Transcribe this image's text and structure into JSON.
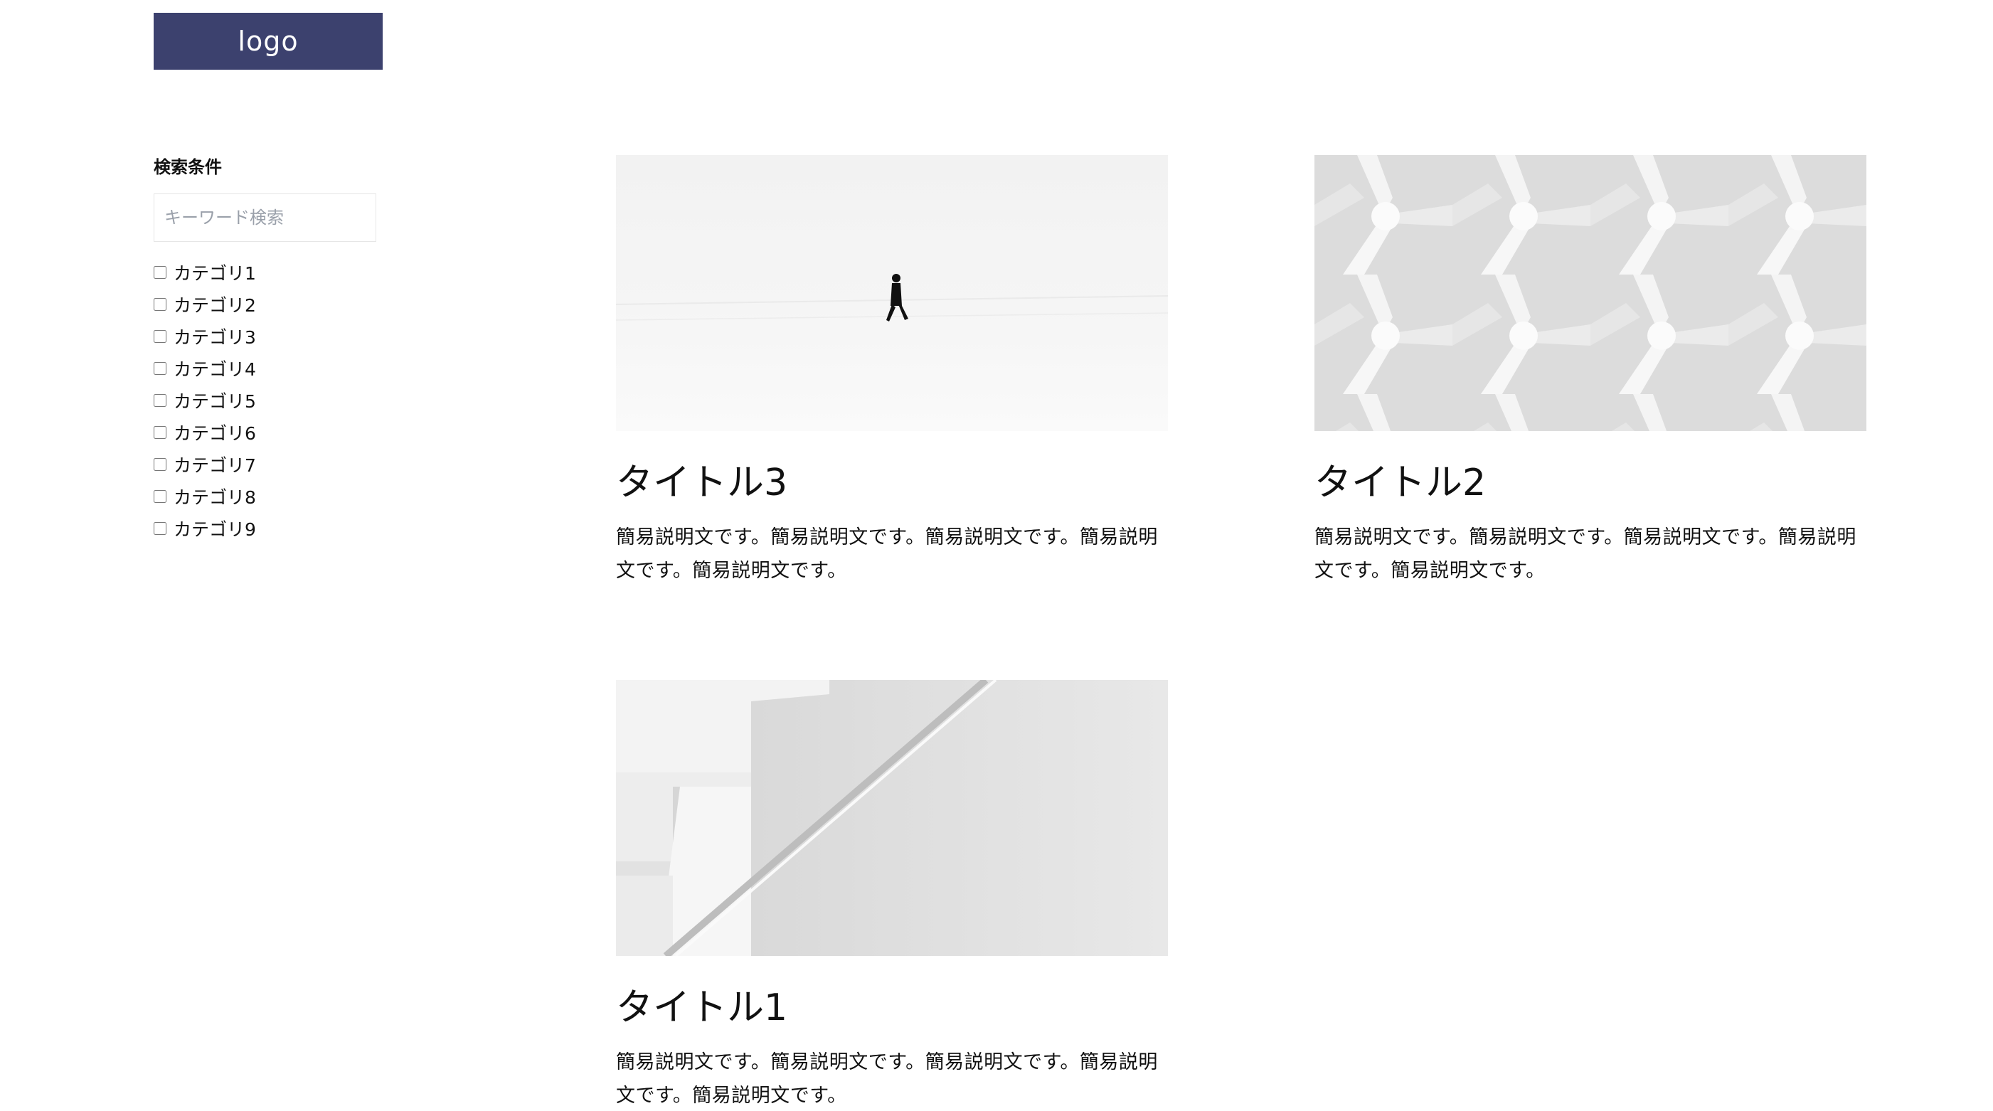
{
  "header": {
    "logo_text": "logo"
  },
  "sidebar": {
    "title": "検索条件",
    "search_placeholder": "キーワード検索",
    "categories": [
      "カテゴリ1",
      "カテゴリ2",
      "カテゴリ3",
      "カテゴリ4",
      "カテゴリ5",
      "カテゴリ6",
      "カテゴリ7",
      "カテゴリ8",
      "カテゴリ9"
    ]
  },
  "cards": [
    {
      "title": "タイトル3",
      "description": "簡易説明文です。簡易説明文です。簡易説明文です。簡易説明文です。簡易説明文です。"
    },
    {
      "title": "タイトル2",
      "description": "簡易説明文です。簡易説明文です。簡易説明文です。簡易説明文です。簡易説明文です。"
    },
    {
      "title": "タイトル1",
      "description": "簡易説明文です。簡易説明文です。簡易説明文です。簡易説明文です。簡易説明文です。"
    }
  ],
  "colors": {
    "logo_bg": "#3c416e",
    "logo_text": "#ffffff"
  }
}
